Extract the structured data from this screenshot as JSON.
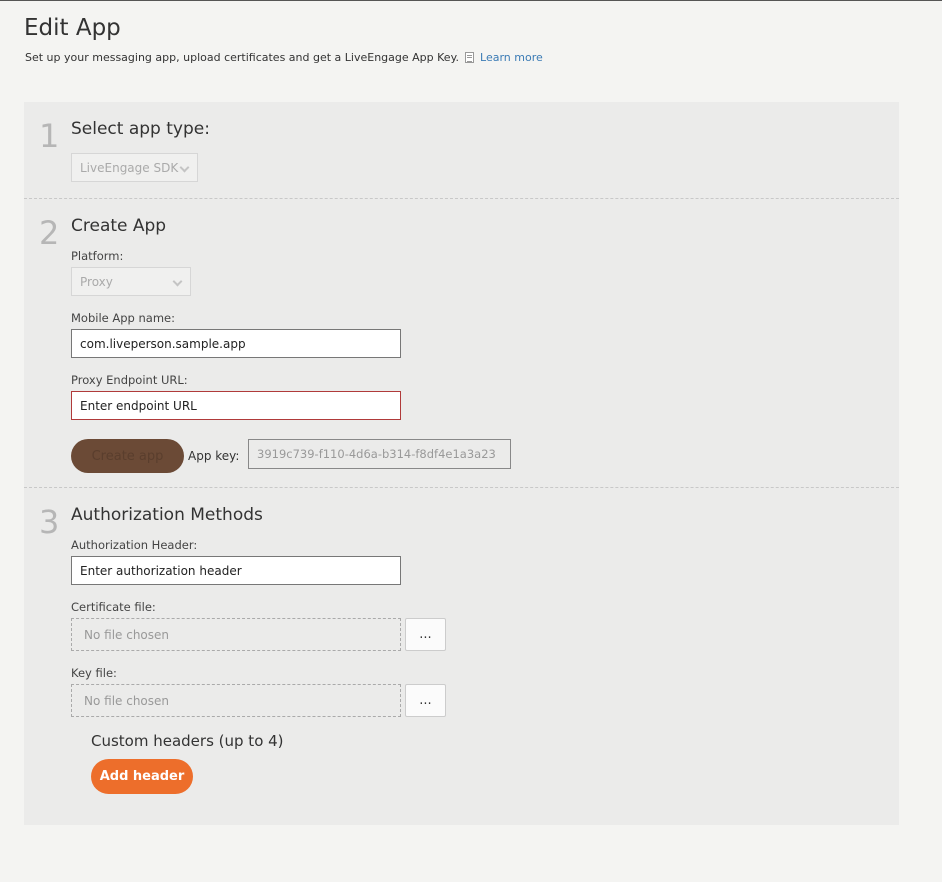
{
  "header": {
    "title": "Edit App",
    "subtitle": "Set up your messaging app, upload certificates and get a LiveEngage App Key.",
    "learn_more": "Learn more"
  },
  "step1": {
    "number": "1",
    "title": "Select app type:",
    "app_type_value": "LiveEngage SDK"
  },
  "step2": {
    "number": "2",
    "title": "Create App",
    "platform_label": "Platform:",
    "platform_value": "Proxy",
    "app_name_label": "Mobile App name:",
    "app_name_value": "com.liveperson.sample.app",
    "endpoint_label": "Proxy Endpoint URL:",
    "endpoint_placeholder": "Enter endpoint URL",
    "create_button": "Create app",
    "app_key_label": "App key:",
    "app_key_value": "3919c739-f110-4d6a-b314-f8df4e1a3a23"
  },
  "step3": {
    "number": "3",
    "title": "Authorization Methods",
    "auth_header_label": "Authorization Header:",
    "auth_header_placeholder": "Enter authorization header",
    "cert_label": "Certificate file:",
    "cert_value": "No file chosen",
    "key_label": "Key file:",
    "key_value": "No file chosen",
    "browse_label": "...",
    "custom_headers_title": "Custom headers (up to 4)",
    "add_header_button": "Add header"
  },
  "colors": {
    "accent": "#ed6e2b",
    "disabled_button": "#6b4a36",
    "link": "#3b7bb5",
    "error_border": "#b03a3a"
  }
}
